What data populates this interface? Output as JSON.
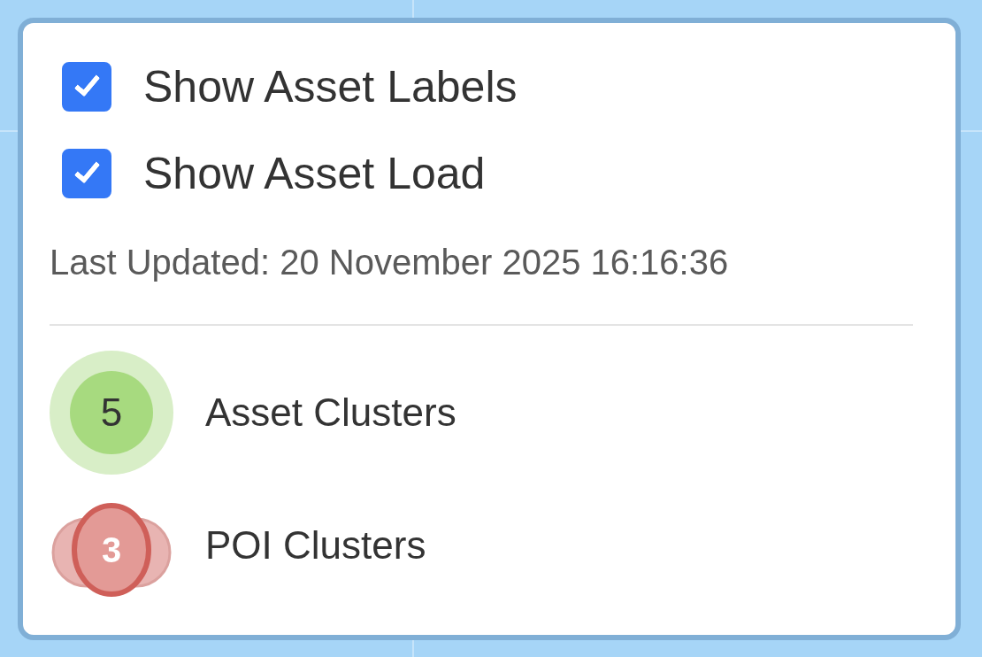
{
  "options": [
    {
      "label": "Show Asset Labels",
      "checked": true
    },
    {
      "label": "Show Asset Load",
      "checked": true
    }
  ],
  "last_updated": "Last Updated: 20 November 2025 16:16:36",
  "legend": [
    {
      "kind": "asset",
      "count": "5",
      "label": "Asset Clusters"
    },
    {
      "kind": "poi",
      "count": "3",
      "label": "POI Clusters"
    }
  ]
}
